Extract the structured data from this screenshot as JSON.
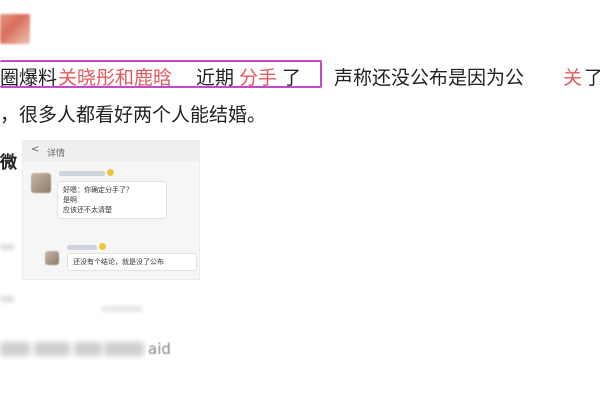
{
  "post": {
    "line1": {
      "seg_a": "圈爆料",
      "seg_b": "关晓彤和鹿晗",
      "seg_c": "近期",
      "seg_d": "分手",
      "seg_e": "了",
      "seg_f": "声称还没公布是因为公",
      "seg_g": "关",
      "seg_h": "了"
    },
    "line2": "，很多人都看好两个人能结婚。",
    "partial_char": "微",
    "blur_tail": "aid",
    "highlight_color": "#c34bc8",
    "red_color": "#e4595d"
  },
  "chat_screenshot": {
    "back_icon": "<",
    "title": "详情",
    "msg1_lines": [
      "好嗯：你确定分手了？",
      "是啊",
      "应该还不太清楚"
    ],
    "msg2_line": "还没有个结论，就是没了公布"
  }
}
